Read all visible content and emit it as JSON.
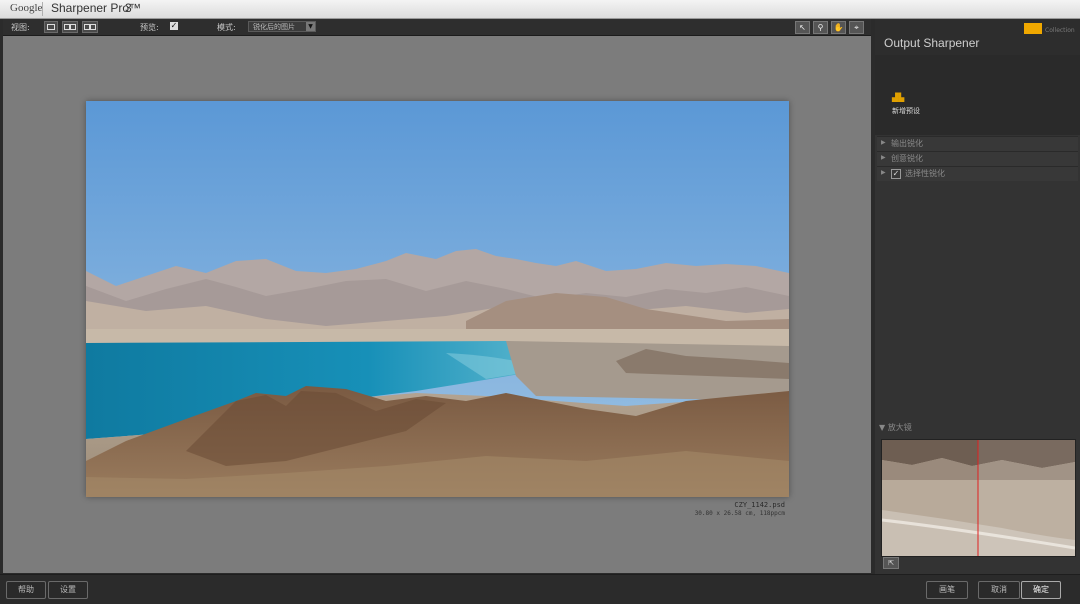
{
  "titlebar": {
    "brand": "Google",
    "product": "Sharpener Pro™",
    "version": "3"
  },
  "toolbar": {
    "view_label": "视图:",
    "preview_label": "预览:",
    "preview_checked": "✓",
    "mode_label": "模式:",
    "mode_value": "锐化后的图片",
    "tools": [
      "arrow-icon",
      "zoom-icon",
      "hand-icon",
      "eyedropper-icon"
    ]
  },
  "image": {
    "filename": "CZY_1142.psd",
    "dimensions": "30.80 x 26.58 cm, 118ppcm"
  },
  "right_panel": {
    "title": "Output Sharpener",
    "logo_text": "Collection",
    "preset_label": "新增预设",
    "sections": [
      {
        "label": "输出锐化"
      },
      {
        "label": "创意锐化"
      },
      {
        "label": "选择性锐化",
        "checked": "✓"
      }
    ],
    "loupe_label": "放大镜"
  },
  "footer": {
    "help": "帮助",
    "settings": "设置",
    "brush": "画笔",
    "cancel": "取消",
    "ok": "确定"
  },
  "colors": {
    "accent": "#f0a800",
    "loupe_divider": "#e02020"
  }
}
